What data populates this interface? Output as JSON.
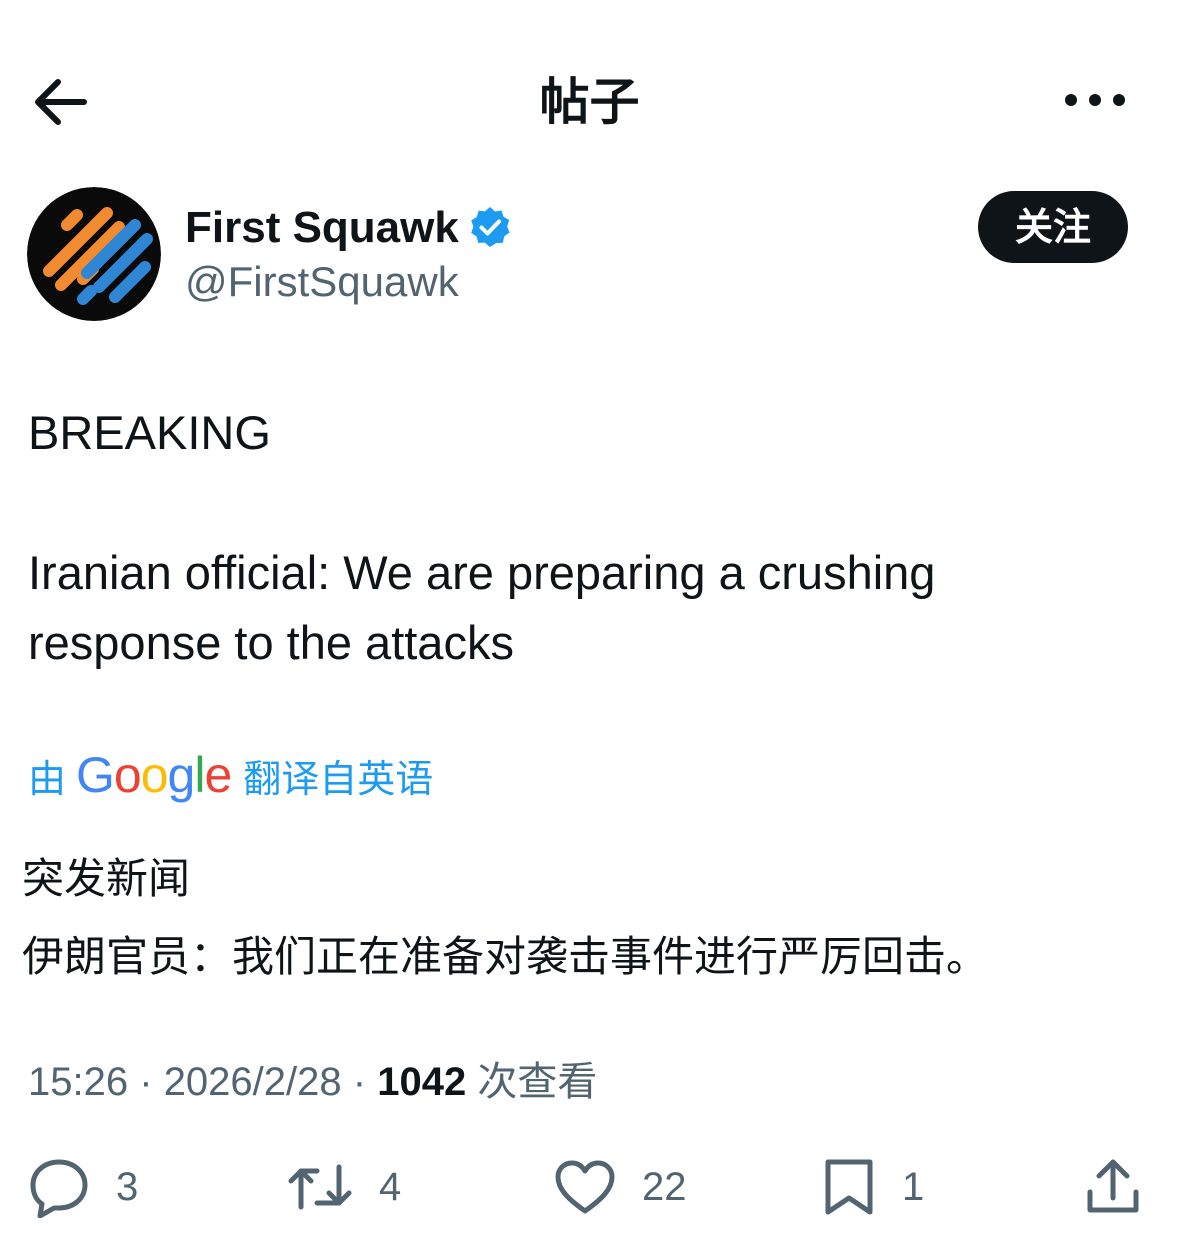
{
  "header": {
    "title": "帖子",
    "back_icon": "arrow-left-icon",
    "more_icon": "more-horizontal-icon"
  },
  "author": {
    "name": "First Squawk",
    "handle": "@FirstSquawk",
    "verified": true,
    "follow_label": "关注"
  },
  "tweet": {
    "lines": [
      "BREAKING",
      "Iranian official: We are preparing a crushing response to the attacks"
    ]
  },
  "translation": {
    "prefix": "由",
    "provider": "Google",
    "suffix": "翻译自英语",
    "lines": [
      "突发新闻",
      "伊朗官员：我们正在准备对袭击事件进行严厉回击。"
    ]
  },
  "meta": {
    "time": "15:26",
    "separator": "·",
    "date": "2026/2/28",
    "views_count": "1042",
    "views_label": "次查看"
  },
  "actions": {
    "replies": "3",
    "reposts": "4",
    "likes": "22",
    "bookmarks": "1"
  },
  "colors": {
    "accent": "#1d9bf0",
    "text": "#0f1419",
    "muted": "#536471",
    "avatar_orange": "#f28a30",
    "avatar_blue": "#2f86d4"
  }
}
